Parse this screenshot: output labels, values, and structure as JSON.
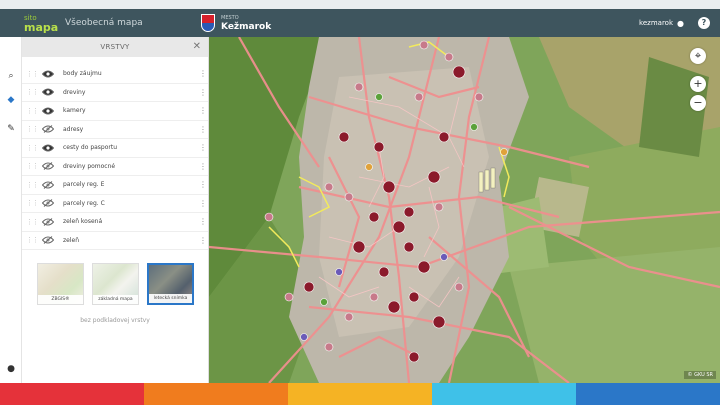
{
  "header": {
    "logo_top": "sito",
    "logo_bottom": "mapa",
    "app_title": "Všeobecná mapa",
    "city_prefix": "MESTO",
    "city_name": "Kežmarok",
    "username": "kezmarok",
    "help": "?"
  },
  "toolbar": {
    "search_icon": "⌕",
    "layers_icon": "◆",
    "brush_icon": "✎",
    "chat_icon": "●"
  },
  "panel": {
    "title": "VRSTVY",
    "close": "✕",
    "layers": [
      {
        "label": "body záujmu",
        "visible": true
      },
      {
        "label": "dreviny",
        "visible": true
      },
      {
        "label": "kamery",
        "visible": true
      },
      {
        "label": "adresy",
        "visible": false
      },
      {
        "label": "cesty do pasportu",
        "visible": true
      },
      {
        "label": "dreviny pomocné",
        "visible": false
      },
      {
        "label": "parcely reg. E",
        "visible": false
      },
      {
        "label": "parcely reg. C",
        "visible": false
      },
      {
        "label": "zeleň kosená",
        "visible": false
      },
      {
        "label": "zeleň",
        "visible": false
      }
    ],
    "basemaps": [
      {
        "label": "ZBGIS®",
        "active": false
      },
      {
        "label": "základná mapa",
        "active": false
      },
      {
        "label": "letecká snímka",
        "active": true
      }
    ],
    "no_basemap": "bez podkladovej vrstvy"
  },
  "map": {
    "controls": {
      "locate": "⌖",
      "zoom_in": "+",
      "zoom_out": "−"
    },
    "attribution": "© GKU SR"
  },
  "colors": {
    "header": "#3e555e",
    "accent_green": "#b9e04a",
    "active_basemap": "#2b77c8",
    "road": "#ef8f8f",
    "poi": "#8b1a2b",
    "footer": [
      "#e5323a",
      "#f07c1e",
      "#f5b324",
      "#3fc1e8",
      "#2b77c8"
    ]
  }
}
